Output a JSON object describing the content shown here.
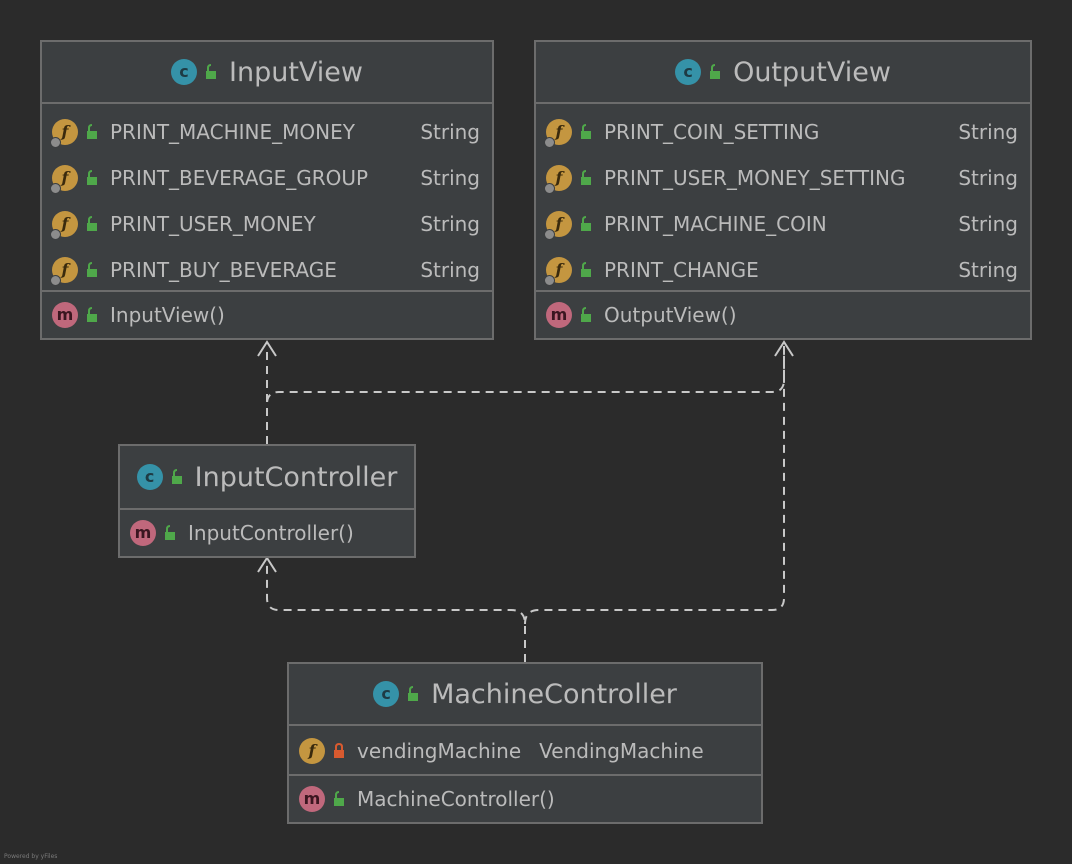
{
  "diagram": {
    "type": "uml-class-diagram",
    "colors": {
      "background": "#2b2b2b",
      "node_fill": "#3c3f41",
      "node_border": "#6c6c6c",
      "text": "#bbbbbb",
      "edge": "#c8c8c8",
      "class_badge": "#3592a8",
      "field_badge": "#c49640",
      "method_badge": "#c0687c",
      "public_icon": "#4fa84a",
      "private_icon": "#d85a2f"
    }
  },
  "nodes": {
    "input_view": {
      "name": "InputView",
      "badge_letter": "c",
      "visibility": "public",
      "fields": [
        {
          "badge_letter": "f",
          "static": true,
          "visibility": "public",
          "name": "PRINT_MACHINE_MONEY",
          "type": "String"
        },
        {
          "badge_letter": "f",
          "static": true,
          "visibility": "public",
          "name": "PRINT_BEVERAGE_GROUP",
          "type": "String"
        },
        {
          "badge_letter": "f",
          "static": true,
          "visibility": "public",
          "name": "PRINT_USER_MONEY",
          "type": "String"
        },
        {
          "badge_letter": "f",
          "static": true,
          "visibility": "public",
          "name": "PRINT_BUY_BEVERAGE",
          "type": "String"
        }
      ],
      "methods": [
        {
          "badge_letter": "m",
          "visibility": "public",
          "name": "InputView()"
        }
      ]
    },
    "output_view": {
      "name": "OutputView",
      "badge_letter": "c",
      "visibility": "public",
      "fields": [
        {
          "badge_letter": "f",
          "static": true,
          "visibility": "public",
          "name": "PRINT_COIN_SETTING",
          "type": "String"
        },
        {
          "badge_letter": "f",
          "static": true,
          "visibility": "public",
          "name": "PRINT_USER_MONEY_SETTING",
          "type": "String"
        },
        {
          "badge_letter": "f",
          "static": true,
          "visibility": "public",
          "name": "PRINT_MACHINE_COIN",
          "type": "String"
        },
        {
          "badge_letter": "f",
          "static": true,
          "visibility": "public",
          "name": "PRINT_CHANGE",
          "type": "String"
        }
      ],
      "methods": [
        {
          "badge_letter": "m",
          "visibility": "public",
          "name": "OutputView()"
        }
      ]
    },
    "input_controller": {
      "name": "InputController",
      "badge_letter": "c",
      "visibility": "public",
      "methods": [
        {
          "badge_letter": "m",
          "visibility": "public",
          "name": "InputController()"
        }
      ]
    },
    "machine_controller": {
      "name": "MachineController",
      "badge_letter": "c",
      "visibility": "public",
      "fields": [
        {
          "badge_letter": "f",
          "static": false,
          "visibility": "private",
          "name": "vendingMachine",
          "type": "VendingMachine"
        }
      ],
      "methods": [
        {
          "badge_letter": "m",
          "visibility": "public",
          "name": "MachineController()"
        }
      ]
    }
  },
  "edges": [
    {
      "from": "InputController",
      "to": "InputView",
      "kind": "dependency"
    },
    {
      "from": "InputController",
      "to": "OutputView",
      "kind": "dependency"
    },
    {
      "from": "MachineController",
      "to": "InputController",
      "kind": "dependency"
    },
    {
      "from": "MachineController",
      "to": "OutputView",
      "kind": "dependency"
    }
  ],
  "footer": {
    "credit": "Powered by yFiles"
  }
}
